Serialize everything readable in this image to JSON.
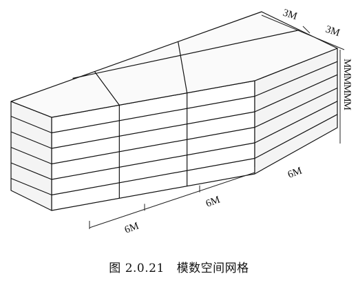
{
  "figure": {
    "caption_number": "图 2.0.21",
    "caption_title": "模数空间网格"
  },
  "dimensions": {
    "depth_top_1": "3M",
    "depth_top_2": "3M",
    "height_right": "MMMMMM",
    "width_front_1": "6M",
    "width_front_2": "6M",
    "width_front_3": "6M"
  },
  "grid": {
    "layers": 6,
    "front_bays": 3,
    "depth_bays": 2
  }
}
